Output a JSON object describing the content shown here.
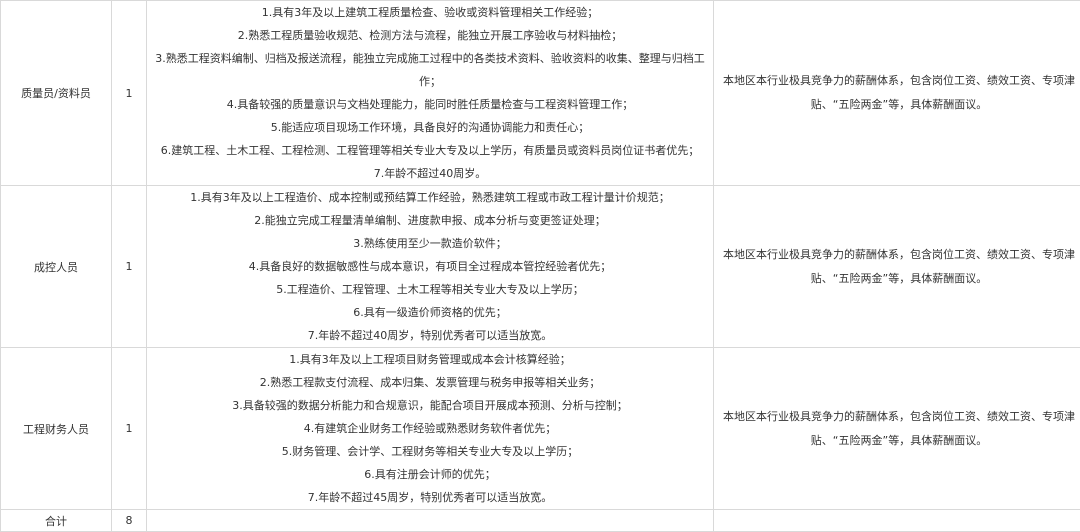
{
  "rows": [
    {
      "position": "质量员/资料员",
      "count": "1",
      "requirements": [
        "1.具有3年及以上建筑工程质量检查、验收或资料管理相关工作经验；",
        "2.熟悉工程质量验收规范、检测方法与流程，能独立开展工序验收与材料抽检；",
        "3.熟悉工程资料编制、归档及报送流程，能独立完成施工过程中的各类技术资料、验收资料的收集、整理与归档工作；",
        "4.具备较强的质量意识与文档处理能力，能同时胜任质量检查与工程资料管理工作；",
        "5.能适应项目现场工作环境，具备良好的沟通协调能力和责任心；",
        "6.建筑工程、土木工程、工程检测、工程管理等相关专业大专及以上学历，有质量员或资料员岗位证书者优先；",
        "7.年龄不超过40周岁。"
      ],
      "salary": "本地区本行业极具竞争力的薪酬体系，包含岗位工资、绩效工资、专项津贴、“五险两金”等，具体薪酬面议。"
    },
    {
      "position": "成控人员",
      "count": "1",
      "requirements": [
        "1.具有3年及以上工程造价、成本控制或预结算工作经验，熟悉建筑工程或市政工程计量计价规范；",
        "2.能独立完成工程量清单编制、进度款申报、成本分析与变更签证处理；",
        "3.熟练使用至少一款造价软件；",
        "4.具备良好的数据敏感性与成本意识，有项目全过程成本管控经验者优先；",
        "5.工程造价、工程管理、土木工程等相关专业大专及以上学历；",
        "6.具有一级造价师资格的优先；",
        "7.年龄不超过40周岁，特别优秀者可以适当放宽。"
      ],
      "salary": "本地区本行业极具竞争力的薪酬体系，包含岗位工资、绩效工资、专项津贴、“五险两金”等，具体薪酬面议。"
    },
    {
      "position": "工程财务人员",
      "count": "1",
      "requirements": [
        "1.具有3年及以上工程项目财务管理或成本会计核算经验；",
        "2.熟悉工程款支付流程、成本归集、发票管理与税务申报等相关业务；",
        "3.具备较强的数据分析能力和合规意识，能配合项目开展成本预测、分析与控制；",
        "4.有建筑企业财务工作经验或熟悉财务软件者优先；",
        "5.财务管理、会计学、工程财务等相关专业大专及以上学历；",
        "6.具有注册会计师的优先；",
        "7.年龄不超过45周岁，特别优秀者可以适当放宽。"
      ],
      "salary": "本地区本行业极具竞争力的薪酬体系，包含岗位工资、绩效工资、专项津贴、“五险两金”等，具体薪酬面议。"
    }
  ],
  "total": {
    "label": "合计",
    "count": "8"
  }
}
